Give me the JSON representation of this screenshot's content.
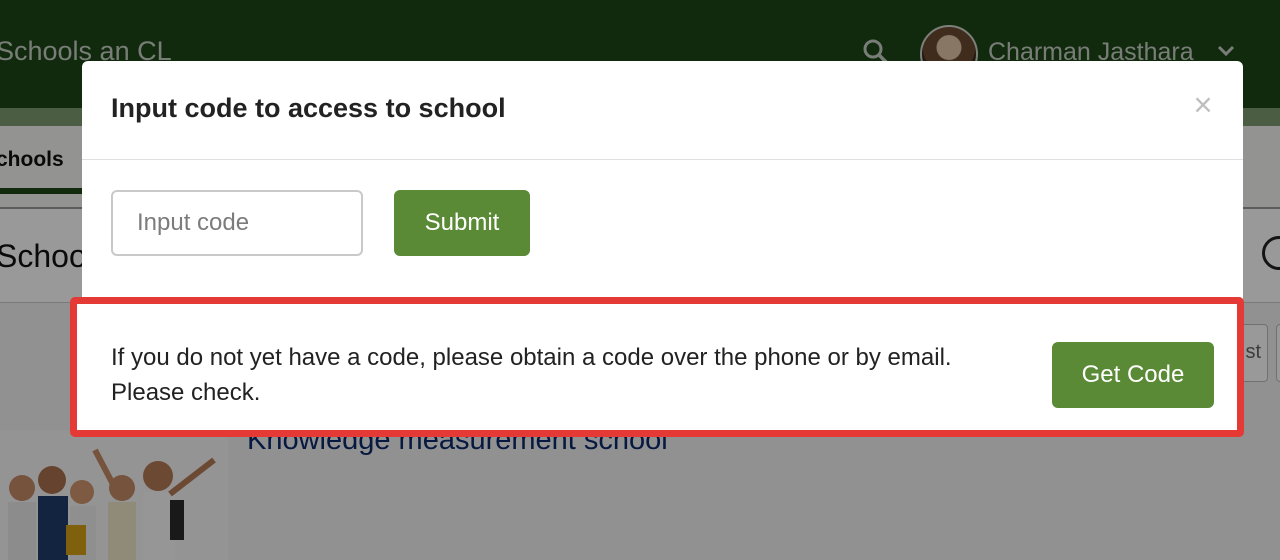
{
  "header": {
    "brand": "Schools an CL",
    "user_name": "Charman Jasthara"
  },
  "nav": {
    "tab_schools": "chools"
  },
  "page": {
    "heading": "Schoo",
    "list_button_fragment": "st",
    "school_title": "Knowledge measurement school"
  },
  "modal": {
    "title": "Input code to access to school",
    "close_label": "×",
    "input_placeholder": "Input code",
    "input_value": "",
    "submit_label": "Submit",
    "notice_text": "If you do not yet have a code, please obtain a code over the phone or by email. Please check.",
    "get_code_label": "Get Code"
  },
  "colors": {
    "header_bg": "#1d4717",
    "accent_green": "#5a8a35",
    "highlight_border": "#e53935"
  },
  "icons": [
    "search-icon",
    "chevron-down-icon",
    "close-icon"
  ]
}
